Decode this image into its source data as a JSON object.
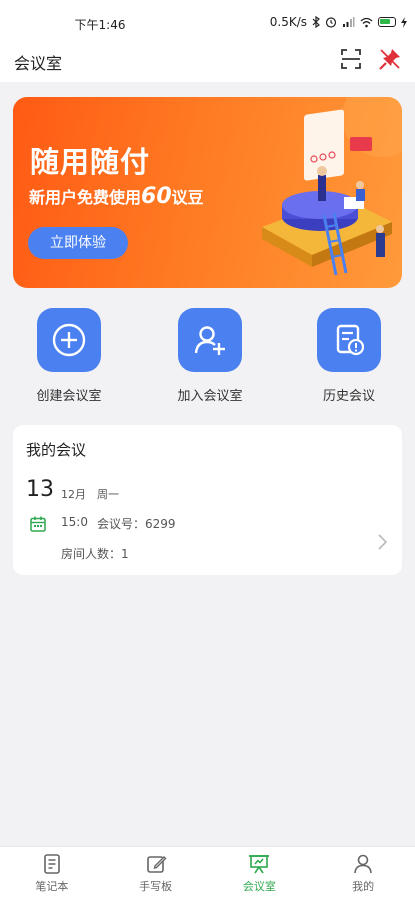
{
  "status": {
    "time": "下午1:46",
    "speed": "0.5K/s"
  },
  "header": {
    "title": "会议室"
  },
  "banner": {
    "title": "随用随付",
    "subtitle_pre": "新用户免费使用",
    "subtitle_num": "60",
    "subtitle_post": "议豆",
    "button": "立即体验"
  },
  "actions": [
    {
      "label": "创建会议室",
      "icon": "plus-circle-icon"
    },
    {
      "label": "加入会议室",
      "icon": "add-user-icon"
    },
    {
      "label": "历史会议",
      "icon": "history-doc-icon"
    }
  ],
  "meeting": {
    "title": "我的会议",
    "day": "13",
    "month": "12月",
    "weekday": "周一",
    "time": "15:0",
    "meeting_no": "会议号：6299",
    "people": "房间人数：1"
  },
  "tabs": [
    {
      "label": "笔记本",
      "icon": "notebook-icon",
      "active": false
    },
    {
      "label": "手写板",
      "icon": "handwriting-icon",
      "active": false
    },
    {
      "label": "会议室",
      "icon": "meeting-room-icon",
      "active": true
    },
    {
      "label": "我的",
      "icon": "profile-icon",
      "active": false
    }
  ],
  "colors": {
    "accent": "#4a80f0",
    "active_tab": "#2fa84f",
    "banner_orange": "#ff6a1a"
  }
}
